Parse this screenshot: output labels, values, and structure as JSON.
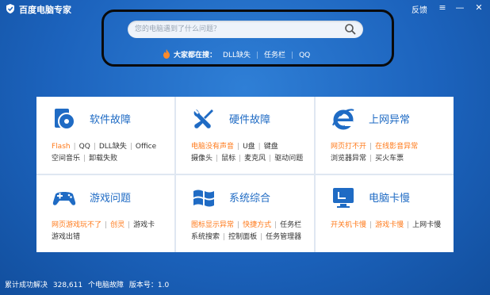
{
  "app": {
    "title": "百度电脑专家"
  },
  "titlebar": {
    "feedback": "反馈",
    "menu_glyph": "≡",
    "minimize_glyph": "—",
    "close_glyph": "✕"
  },
  "search": {
    "placeholder": "您的电脑遇到了什么问题？",
    "hot_label": "大家都在搜：",
    "hot_items": [
      "DLL缺失",
      "任务栏",
      "QQ"
    ]
  },
  "categories": [
    {
      "title": "软件故障",
      "icon": "software-disc-icon",
      "line1": [
        {
          "label": "Flash",
          "hot": true
        },
        {
          "label": "QQ",
          "hot": false
        },
        {
          "label": "DLL缺失",
          "hot": false
        },
        {
          "label": "Office",
          "hot": false
        }
      ],
      "line2": [
        {
          "label": "空间音乐",
          "hot": false
        },
        {
          "label": "卸载失败",
          "hot": false
        }
      ]
    },
    {
      "title": "硬件故障",
      "icon": "tools-icon",
      "line1": [
        {
          "label": "电脑没有声音",
          "hot": true
        },
        {
          "label": "U盘",
          "hot": false
        },
        {
          "label": "键盘",
          "hot": false
        }
      ],
      "line2": [
        {
          "label": "摄像头",
          "hot": false
        },
        {
          "label": "鼠标",
          "hot": false
        },
        {
          "label": "麦克风",
          "hot": false
        },
        {
          "label": "驱动问题",
          "hot": false
        }
      ]
    },
    {
      "title": "上网异常",
      "icon": "ie-browser-icon",
      "line1": [
        {
          "label": "网页打不开",
          "hot": true
        },
        {
          "label": "在线影音异常",
          "hot": true
        }
      ],
      "line2": [
        {
          "label": "浏览器异常",
          "hot": false
        },
        {
          "label": "买火车票",
          "hot": false
        }
      ]
    },
    {
      "title": "游戏问题",
      "icon": "gamepad-icon",
      "line1": [
        {
          "label": "网页游戏玩不了",
          "hot": true
        },
        {
          "label": "创灵",
          "hot": true
        },
        {
          "label": "游戏卡",
          "hot": false
        }
      ],
      "line2": [
        {
          "label": "游戏出错",
          "hot": false
        }
      ]
    },
    {
      "title": "系统综合",
      "icon": "windows-logo-icon",
      "line1": [
        {
          "label": "图标显示异常",
          "hot": true
        },
        {
          "label": "快捷方式",
          "hot": true
        },
        {
          "label": "任务栏",
          "hot": false
        }
      ],
      "line2": [
        {
          "label": "系统搜索",
          "hot": false
        },
        {
          "label": "控制面板",
          "hot": false
        },
        {
          "label": "任务管理器",
          "hot": false
        }
      ]
    },
    {
      "title": "电脑卡慢",
      "icon": "monitor-icon",
      "line1": [
        {
          "label": "开关机卡慢",
          "hot": true
        },
        {
          "label": "游戏卡慢",
          "hot": true
        },
        {
          "label": "上网卡慢",
          "hot": false
        }
      ],
      "line2": []
    }
  ],
  "status": {
    "solved_label": "累计成功解决",
    "solved_count": "328,611",
    "solved_unit": "个电脑故障",
    "version_label": "版本号：",
    "version": "1.0"
  },
  "colors": {
    "accent": "#1f6bc4",
    "hot": "#ff7a1a",
    "background": "#1c63bd"
  }
}
